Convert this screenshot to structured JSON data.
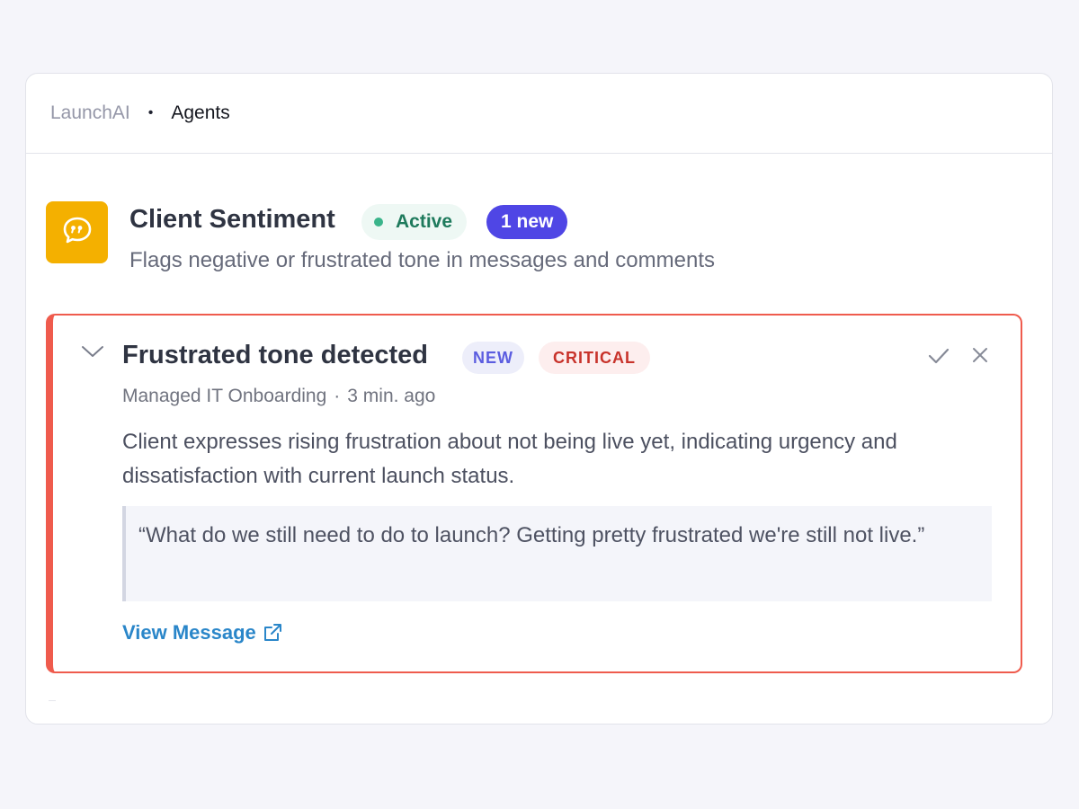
{
  "breadcrumb": {
    "root": "LaunchAI",
    "separator": "•",
    "current": "Agents"
  },
  "agent": {
    "icon": "quote-bubble-icon",
    "icon_color": "#f4b000",
    "name": "Client Sentiment",
    "status": "Active",
    "status_color": "#3ab48a",
    "new_count": "1 new",
    "description": "Flags negative or frustrated tone in messages and comments"
  },
  "alert": {
    "accent_color": "#ef5b4d",
    "title": "Frustrated tone detected",
    "tag_new": "NEW",
    "tag_severity": "CRITICAL",
    "project": "Managed IT Onboarding",
    "meta_separator": "·",
    "time_ago": "3 min. ago",
    "summary": "Client expresses rising frustration about not being live yet, indicating urgency and dissatisfaction with current launch status.",
    "quote": "“What do we still need to do to launch? Getting pretty frustrated we're still not live.”",
    "link_label": "View Message",
    "actions": [
      "check-icon",
      "close-icon"
    ]
  }
}
